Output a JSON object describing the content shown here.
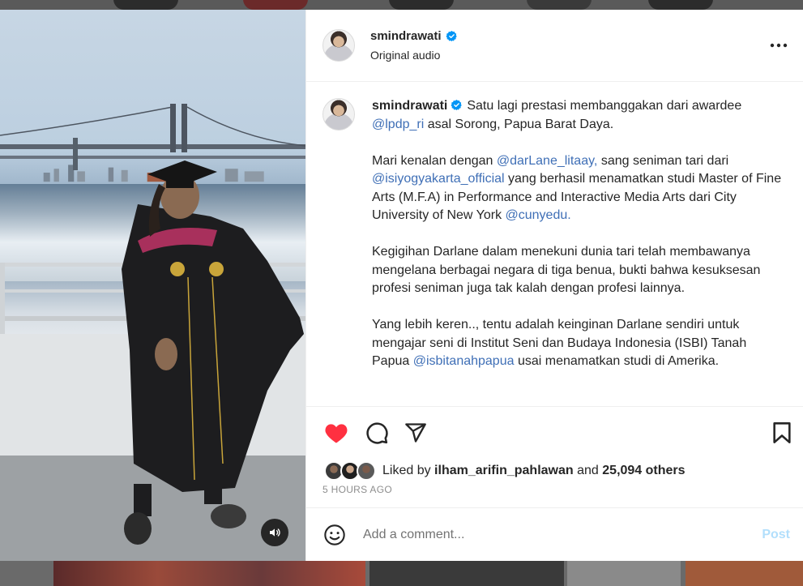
{
  "post": {
    "author": "smindrawati",
    "audio_label": "Original audio"
  },
  "caption": {
    "author": "smindrawati",
    "p1_text1": "Satu lagi prestasi membanggakan dari awardee",
    "p1_mention1": "@lpdp_ri",
    "p1_text2": "asal Sorong, Papua Barat Daya.",
    "p2_text1": "Mari kenalan dengan",
    "p2_mention1": "@darLane_litaay,",
    "p2_text2": "sang seniman tari dari",
    "p2_mention2": "@isiyogyakarta_official",
    "p2_text3": "yang berhasil menamatkan studi Master of Fine Arts (M.F.A) in Performance and Interactive Media Arts dari City University of New York",
    "p2_mention3": "@cunyedu.",
    "p3_text": "Kegigihan Darlane dalam menekuni dunia tari telah membawanya mengelana berbagai negara di tiga benua, bukti bahwa kesuksesan profesi seniman juga tak kalah dengan profesi lainnya.",
    "p4_text1": "Yang lebih keren.., tentu adalah keinginan Darlane sendiri untuk mengajar seni di Institut Seni dan Budaya Indonesia (ISBI) Tanah Papua",
    "p4_mention1": "@isbitanahpapua",
    "p4_text2": "usai menamatkan studi di Amerika."
  },
  "likes": {
    "prefix": "Liked by",
    "user": "ilham_arifin_pahlawan",
    "and": "and",
    "others": "25,094 others"
  },
  "timestamp": "5 HOURS AGO",
  "comment": {
    "placeholder": "Add a comment...",
    "post_label": "Post"
  },
  "icons": {
    "like": "heart-icon",
    "comment": "comment-icon",
    "share": "share-icon",
    "save": "bookmark-icon",
    "more": "more-icon",
    "emoji": "emoji-icon",
    "audio": "speaker-icon",
    "verified": "verified-badge-icon"
  },
  "colors": {
    "heart": "#ff3040",
    "verified": "#0095f6",
    "mention": "#00376b",
    "post_disabled": "#b2dffc"
  }
}
